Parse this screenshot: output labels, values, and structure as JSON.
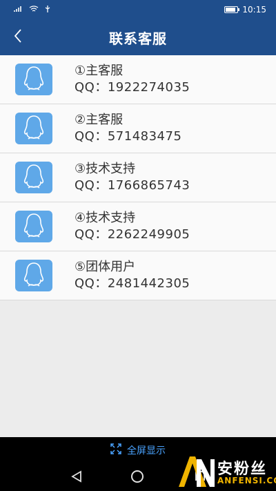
{
  "status_bar": {
    "time": "10:15",
    "battery_level": 0.85
  },
  "header": {
    "title": "联系客服",
    "back_icon": "chevron-left-icon"
  },
  "contacts": [
    {
      "name": "①主客服",
      "qq": "QQ：1922274035"
    },
    {
      "name": "②主客服",
      "qq": "QQ：571483475"
    },
    {
      "name": "③技术支持",
      "qq": "QQ：1766865743"
    },
    {
      "name": "④技术支持",
      "qq": "QQ：2262249905"
    },
    {
      "name": "⑤团体用户",
      "qq": "QQ：2481442305"
    }
  ],
  "bottom": {
    "fullscreen_label": "全屏显示"
  },
  "watermark": {
    "logo_text": "AN",
    "name_cn": "安粉丝",
    "name_en": "ANFENSI.COM"
  },
  "colors": {
    "primary": "#1f4e8c",
    "avatar_bg": "#5fa8e8",
    "fullscreen_text": "#4aa3ff",
    "watermark_en": "#f0b400"
  }
}
